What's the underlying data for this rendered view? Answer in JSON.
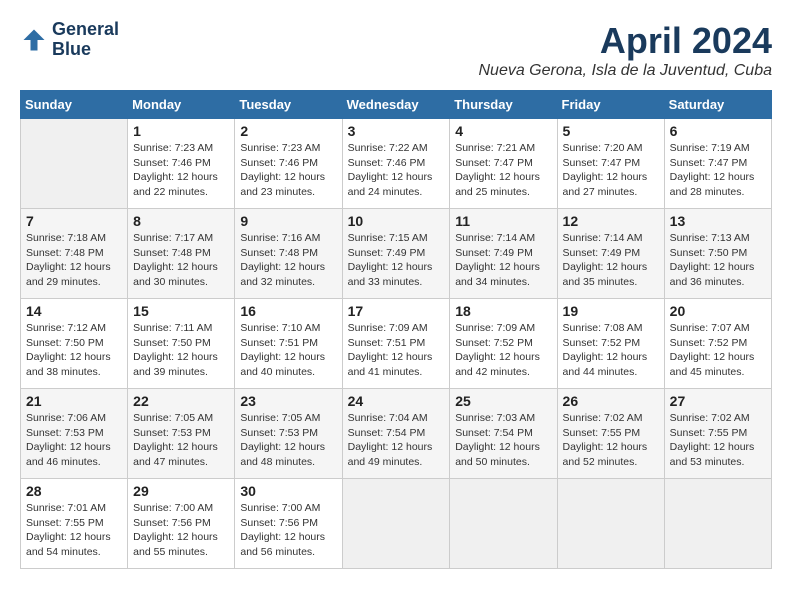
{
  "header": {
    "logo_line1": "General",
    "logo_line2": "Blue",
    "month": "April 2024",
    "location": "Nueva Gerona, Isla de la Juventud, Cuba"
  },
  "weekdays": [
    "Sunday",
    "Monday",
    "Tuesday",
    "Wednesday",
    "Thursday",
    "Friday",
    "Saturday"
  ],
  "weeks": [
    [
      {
        "day": "",
        "sunrise": "",
        "sunset": "",
        "daylight": ""
      },
      {
        "day": "1",
        "sunrise": "Sunrise: 7:23 AM",
        "sunset": "Sunset: 7:46 PM",
        "daylight": "Daylight: 12 hours and 22 minutes."
      },
      {
        "day": "2",
        "sunrise": "Sunrise: 7:23 AM",
        "sunset": "Sunset: 7:46 PM",
        "daylight": "Daylight: 12 hours and 23 minutes."
      },
      {
        "day": "3",
        "sunrise": "Sunrise: 7:22 AM",
        "sunset": "Sunset: 7:46 PM",
        "daylight": "Daylight: 12 hours and 24 minutes."
      },
      {
        "day": "4",
        "sunrise": "Sunrise: 7:21 AM",
        "sunset": "Sunset: 7:47 PM",
        "daylight": "Daylight: 12 hours and 25 minutes."
      },
      {
        "day": "5",
        "sunrise": "Sunrise: 7:20 AM",
        "sunset": "Sunset: 7:47 PM",
        "daylight": "Daylight: 12 hours and 27 minutes."
      },
      {
        "day": "6",
        "sunrise": "Sunrise: 7:19 AM",
        "sunset": "Sunset: 7:47 PM",
        "daylight": "Daylight: 12 hours and 28 minutes."
      }
    ],
    [
      {
        "day": "7",
        "sunrise": "Sunrise: 7:18 AM",
        "sunset": "Sunset: 7:48 PM",
        "daylight": "Daylight: 12 hours and 29 minutes."
      },
      {
        "day": "8",
        "sunrise": "Sunrise: 7:17 AM",
        "sunset": "Sunset: 7:48 PM",
        "daylight": "Daylight: 12 hours and 30 minutes."
      },
      {
        "day": "9",
        "sunrise": "Sunrise: 7:16 AM",
        "sunset": "Sunset: 7:48 PM",
        "daylight": "Daylight: 12 hours and 32 minutes."
      },
      {
        "day": "10",
        "sunrise": "Sunrise: 7:15 AM",
        "sunset": "Sunset: 7:49 PM",
        "daylight": "Daylight: 12 hours and 33 minutes."
      },
      {
        "day": "11",
        "sunrise": "Sunrise: 7:14 AM",
        "sunset": "Sunset: 7:49 PM",
        "daylight": "Daylight: 12 hours and 34 minutes."
      },
      {
        "day": "12",
        "sunrise": "Sunrise: 7:14 AM",
        "sunset": "Sunset: 7:49 PM",
        "daylight": "Daylight: 12 hours and 35 minutes."
      },
      {
        "day": "13",
        "sunrise": "Sunrise: 7:13 AM",
        "sunset": "Sunset: 7:50 PM",
        "daylight": "Daylight: 12 hours and 36 minutes."
      }
    ],
    [
      {
        "day": "14",
        "sunrise": "Sunrise: 7:12 AM",
        "sunset": "Sunset: 7:50 PM",
        "daylight": "Daylight: 12 hours and 38 minutes."
      },
      {
        "day": "15",
        "sunrise": "Sunrise: 7:11 AM",
        "sunset": "Sunset: 7:50 PM",
        "daylight": "Daylight: 12 hours and 39 minutes."
      },
      {
        "day": "16",
        "sunrise": "Sunrise: 7:10 AM",
        "sunset": "Sunset: 7:51 PM",
        "daylight": "Daylight: 12 hours and 40 minutes."
      },
      {
        "day": "17",
        "sunrise": "Sunrise: 7:09 AM",
        "sunset": "Sunset: 7:51 PM",
        "daylight": "Daylight: 12 hours and 41 minutes."
      },
      {
        "day": "18",
        "sunrise": "Sunrise: 7:09 AM",
        "sunset": "Sunset: 7:52 PM",
        "daylight": "Daylight: 12 hours and 42 minutes."
      },
      {
        "day": "19",
        "sunrise": "Sunrise: 7:08 AM",
        "sunset": "Sunset: 7:52 PM",
        "daylight": "Daylight: 12 hours and 44 minutes."
      },
      {
        "day": "20",
        "sunrise": "Sunrise: 7:07 AM",
        "sunset": "Sunset: 7:52 PM",
        "daylight": "Daylight: 12 hours and 45 minutes."
      }
    ],
    [
      {
        "day": "21",
        "sunrise": "Sunrise: 7:06 AM",
        "sunset": "Sunset: 7:53 PM",
        "daylight": "Daylight: 12 hours and 46 minutes."
      },
      {
        "day": "22",
        "sunrise": "Sunrise: 7:05 AM",
        "sunset": "Sunset: 7:53 PM",
        "daylight": "Daylight: 12 hours and 47 minutes."
      },
      {
        "day": "23",
        "sunrise": "Sunrise: 7:05 AM",
        "sunset": "Sunset: 7:53 PM",
        "daylight": "Daylight: 12 hours and 48 minutes."
      },
      {
        "day": "24",
        "sunrise": "Sunrise: 7:04 AM",
        "sunset": "Sunset: 7:54 PM",
        "daylight": "Daylight: 12 hours and 49 minutes."
      },
      {
        "day": "25",
        "sunrise": "Sunrise: 7:03 AM",
        "sunset": "Sunset: 7:54 PM",
        "daylight": "Daylight: 12 hours and 50 minutes."
      },
      {
        "day": "26",
        "sunrise": "Sunrise: 7:02 AM",
        "sunset": "Sunset: 7:55 PM",
        "daylight": "Daylight: 12 hours and 52 minutes."
      },
      {
        "day": "27",
        "sunrise": "Sunrise: 7:02 AM",
        "sunset": "Sunset: 7:55 PM",
        "daylight": "Daylight: 12 hours and 53 minutes."
      }
    ],
    [
      {
        "day": "28",
        "sunrise": "Sunrise: 7:01 AM",
        "sunset": "Sunset: 7:55 PM",
        "daylight": "Daylight: 12 hours and 54 minutes."
      },
      {
        "day": "29",
        "sunrise": "Sunrise: 7:00 AM",
        "sunset": "Sunset: 7:56 PM",
        "daylight": "Daylight: 12 hours and 55 minutes."
      },
      {
        "day": "30",
        "sunrise": "Sunrise: 7:00 AM",
        "sunset": "Sunset: 7:56 PM",
        "daylight": "Daylight: 12 hours and 56 minutes."
      },
      {
        "day": "",
        "sunrise": "",
        "sunset": "",
        "daylight": ""
      },
      {
        "day": "",
        "sunrise": "",
        "sunset": "",
        "daylight": ""
      },
      {
        "day": "",
        "sunrise": "",
        "sunset": "",
        "daylight": ""
      },
      {
        "day": "",
        "sunrise": "",
        "sunset": "",
        "daylight": ""
      }
    ]
  ]
}
